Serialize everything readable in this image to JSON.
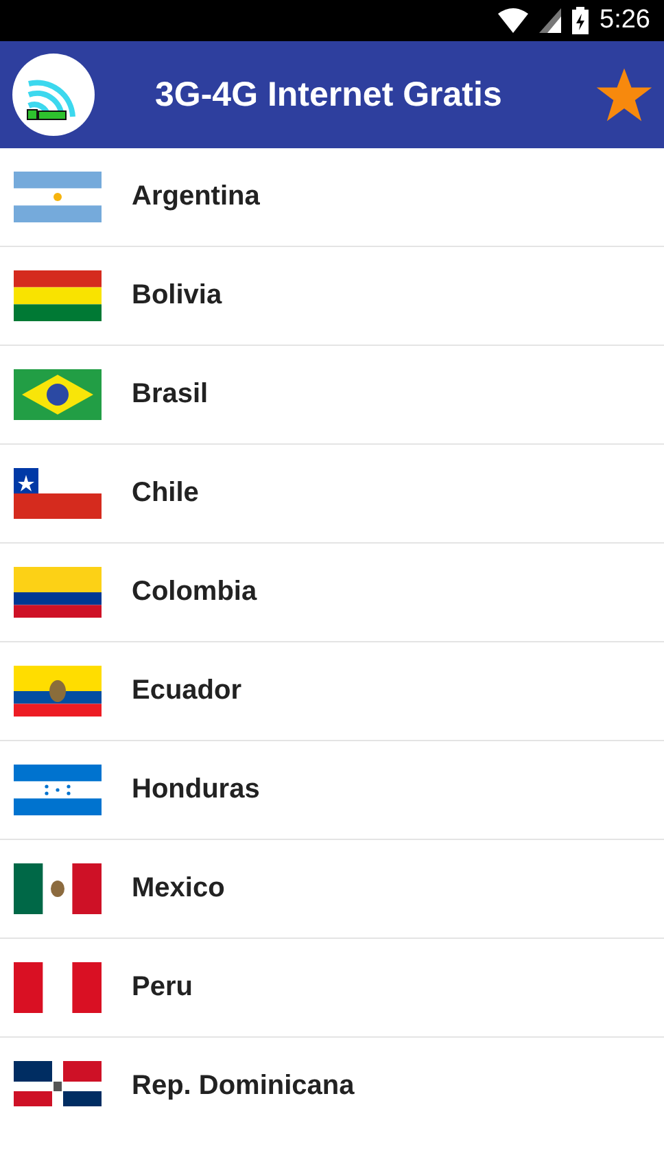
{
  "status_bar": {
    "time": "5:26"
  },
  "app_bar": {
    "title": "3G-4G Internet Gratis"
  },
  "countries": [
    {
      "name": "Argentina"
    },
    {
      "name": "Bolivia"
    },
    {
      "name": "Brasil"
    },
    {
      "name": "Chile"
    },
    {
      "name": "Colombia"
    },
    {
      "name": "Ecuador"
    },
    {
      "name": "Honduras"
    },
    {
      "name": "Mexico"
    },
    {
      "name": "Peru"
    },
    {
      "name": "Rep. Dominicana"
    }
  ]
}
